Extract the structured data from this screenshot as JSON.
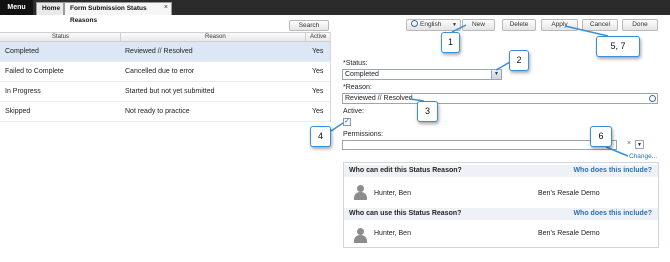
{
  "topbar": {
    "menu_label": "Menu",
    "tabs": [
      {
        "label": "Home"
      },
      {
        "label": "Form Submission Status Reasons",
        "close": "×"
      }
    ]
  },
  "left": {
    "search_label": "Search",
    "columns": [
      "Status",
      "Reason",
      "Active"
    ],
    "rows": [
      {
        "status": "Completed",
        "reason": "Reviewed // Resolved",
        "active": "Yes"
      },
      {
        "status": "Failed to Complete",
        "reason": "Cancelled due to error",
        "active": "Yes"
      },
      {
        "status": "In Progress",
        "reason": "Started but not yet submitted",
        "active": "Yes"
      },
      {
        "status": "Skipped",
        "reason": "Not ready to practice",
        "active": "Yes"
      }
    ]
  },
  "toolbar": {
    "language": "English",
    "new_label": "New",
    "delete_label": "Delete",
    "apply_label": "Apply",
    "cancel_label": "Cancel",
    "done_label": "Done"
  },
  "form": {
    "status_label": "*Status:",
    "status_value": "Completed",
    "reason_label": "*Reason:",
    "reason_value": "Reviewed // Resolved",
    "active_label": "Active:",
    "active_check": "✓",
    "permissions_label": "Permissions:",
    "perm_clear": "×",
    "change_link": "Change..."
  },
  "permissions_box": {
    "edit_title": "Who can edit this Status Reason?",
    "use_title": "Who can use this Status Reason?",
    "includes_link": "Who does this include?",
    "edit_user": "Hunter, Ben",
    "edit_group": "Ben's Resale Demo",
    "use_user": "Hunter, Ben",
    "use_group": "Ben's Resale Demo"
  },
  "callouts": {
    "c1": "1",
    "c2": "2",
    "c3": "3",
    "c4": "4",
    "c5": "5, 7",
    "c6": "6"
  },
  "colors": {
    "accent": "#2a6fb5",
    "callout_border": "#3a8fd8",
    "selected_row": "#dbe7f4",
    "topbar": "#2b2b2b"
  },
  "icons": [
    "globe-icon",
    "dropdown-caret-icon",
    "checkbox-check-icon",
    "person-avatar-icon",
    "clear-icon"
  ]
}
